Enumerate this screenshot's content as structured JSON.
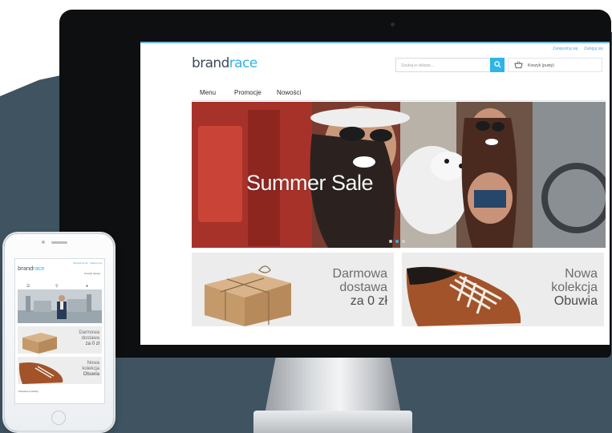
{
  "desktop": {
    "top_links": [
      "Zarejestruj się",
      "Zaloguj się"
    ],
    "logo": {
      "part1": "brand",
      "part2": "race"
    },
    "search": {
      "placeholder": "Szukaj w sklepie..."
    },
    "cart": {
      "label": "Koszyk (pusty)"
    },
    "nav": [
      "Menu",
      "Promocje",
      "Nowości"
    ],
    "hero": {
      "title": "Summer Sale"
    },
    "promos": [
      {
        "lines": [
          "Darmowa",
          "dostawa",
          "za 0 zł"
        ]
      },
      {
        "lines": [
          "Nowa",
          "kolekcja",
          "Obuwia"
        ]
      }
    ]
  },
  "mobile": {
    "logo": {
      "part1": "brand",
      "part2": "race"
    },
    "top_links": "Zarejestruj się · Zaloguj się",
    "cart": "Koszyk (pusty)",
    "promos": [
      {
        "lines": [
          "Darmowa",
          "dostawa",
          "za 0 zł"
        ]
      },
      {
        "lines": [
          "Nowa",
          "kolekcja",
          "Obuwia"
        ]
      }
    ],
    "featured_label": "Polecane produkty"
  },
  "colors": {
    "accent": "#2fb4e8",
    "background_slate": "#3f5360",
    "bezel": "#0e0f11"
  }
}
